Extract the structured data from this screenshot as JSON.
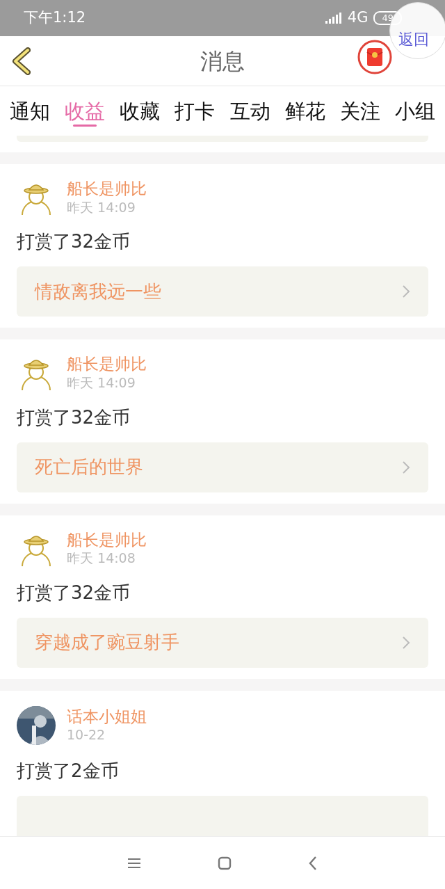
{
  "status_bar": {
    "time": "下午1:12",
    "network": "4G",
    "battery": "49"
  },
  "floating_button": {
    "label": "返回"
  },
  "header": {
    "title": "消息"
  },
  "tabs": [
    {
      "label": "通知",
      "selected": false
    },
    {
      "label": "收益",
      "selected": true
    },
    {
      "label": "收藏",
      "selected": false
    },
    {
      "label": "打卡",
      "selected": false
    },
    {
      "label": "互动",
      "selected": false
    },
    {
      "label": "鲜花",
      "selected": false
    },
    {
      "label": "关注",
      "selected": false
    },
    {
      "label": "小组",
      "selected": false
    }
  ],
  "messages": [
    {
      "user": "船长是帅比",
      "time": "昨天 14:09",
      "avatar": {
        "kind": "cartoon"
      },
      "text": "打赏了32金币",
      "link_title": "情敌离我远一些"
    },
    {
      "user": "船长是帅比",
      "time": "昨天 14:09",
      "avatar": {
        "kind": "cartoon"
      },
      "text": "打赏了32金币",
      "link_title": "死亡后的世界"
    },
    {
      "user": "船长是帅比",
      "time": "昨天 14:08",
      "avatar": {
        "kind": "cartoon"
      },
      "text": "打赏了32金币",
      "link_title": "穿越成了豌豆射手"
    },
    {
      "user": "话本小姐姐",
      "time": "10-22",
      "avatar": {
        "kind": "photo"
      },
      "text": "打赏了2金币"
    }
  ]
}
